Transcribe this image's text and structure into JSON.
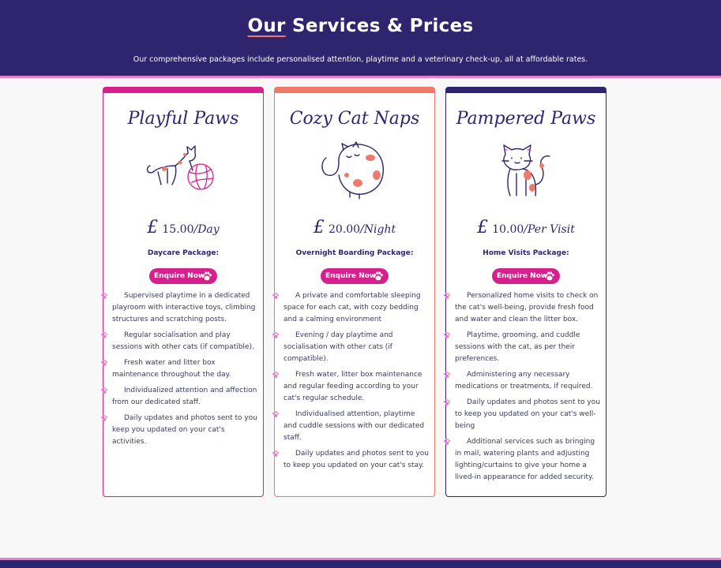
{
  "header": {
    "title_first": "Our",
    "title_rest": " Services & Prices",
    "subtitle": "Our comprehensive packages include personalised attention, playtime and a veterinary check-up, all at affordable rates."
  },
  "colors": {
    "navy": "#2e256e",
    "pink": "#d6208e",
    "coral": "#f07a6a"
  },
  "cards": [
    {
      "title": "Playful Paws",
      "accent": "#d6208e",
      "icon": "cat-with-yarn-ball-icon",
      "price_currency": "£",
      "price_amount": "15.00",
      "price_unit": "/Day",
      "package": "Daycare Package:",
      "button": "Enquire Now",
      "features": [
        "Supervised playtime in a dedicated playroom with interactive toys, climbing structures and scratching posts.",
        "Regular socialisation and play sessions with other cats (if compatible).",
        "Fresh water and litter box maintenance throughout the day.",
        "Individualized attention and affection from our dedicated staff.",
        "Daily updates and photos sent to you keep you updated on your cat's activities."
      ]
    },
    {
      "title": "Cozy Cat Naps",
      "accent": "#f07a6a",
      "icon": "sleeping-cat-icon",
      "price_currency": "£",
      "price_amount": "20.00",
      "price_unit": "/Night",
      "package": "Overnight Boarding Package:",
      "button": "Enquire Now",
      "features": [
        "A private and comfortable sleeping space for each cat, with cozy bedding and a calming environment",
        "Evening / day playtime and socialisation with other cats (if compatible).",
        "Fresh water, litter box maintenance and regular feeding according to your cat's regular schedule.",
        "Individualised attention, playtime and cuddle sessions with our dedicated staff.",
        "Daily updates and photos sent to you to keep you updated on your cat's stay."
      ]
    },
    {
      "title": "Pampered Paws",
      "accent": "#2e256e",
      "icon": "standing-cat-icon",
      "price_currency": "£",
      "price_amount": "10.00",
      "price_unit": "/Per Visit",
      "package": "Home Visits Package:",
      "button": "Enquire Now",
      "features": [
        "Personalized home visits to check on the cat's well-being, provide fresh food and water and clean the litter box.",
        "Playtime, grooming, and cuddle sessions with the cat, as per their preferences.",
        "Administering any necessary medications or treatments, if required.",
        "Daily updates and photos sent to you to keep you updated on your cat's well-being",
        "Additional services such as bringing in mail, watering plants and adjusting lighting/curtains to give your home a lived-in appearance for added security."
      ]
    }
  ]
}
